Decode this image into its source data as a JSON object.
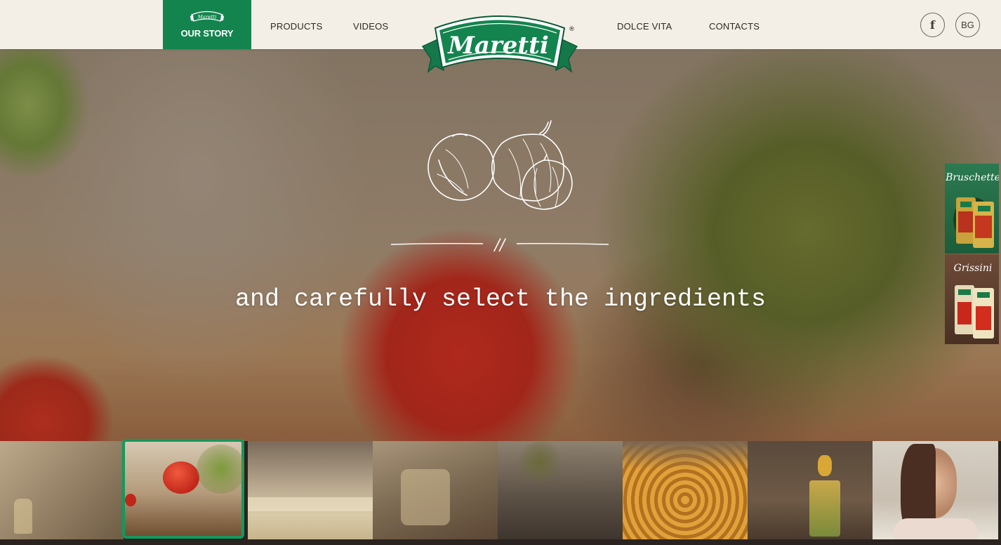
{
  "brand": {
    "name": "Maretti",
    "registered": "®"
  },
  "nav": {
    "active": "OUR STORY",
    "items": [
      "PRODUCTS",
      "VIDEOS",
      "DOLCE VITA",
      "CONTACTS"
    ]
  },
  "social": {
    "facebook": "f",
    "language": "BG"
  },
  "hero": {
    "divider_mark": "//",
    "tagline": "and carefully select the ingredients",
    "illustration": "onion-garlic-icon"
  },
  "side_tabs": [
    {
      "title": "Bruschette",
      "bg": "#2a6a48"
    },
    {
      "title": "Grissini",
      "bg": "#5a3a2a"
    }
  ],
  "filmstrip": {
    "active_index": 1,
    "count": 8
  },
  "colors": {
    "brand_green": "#14844f",
    "header_bg": "#f3efe6",
    "active_outline": "#15985d"
  }
}
